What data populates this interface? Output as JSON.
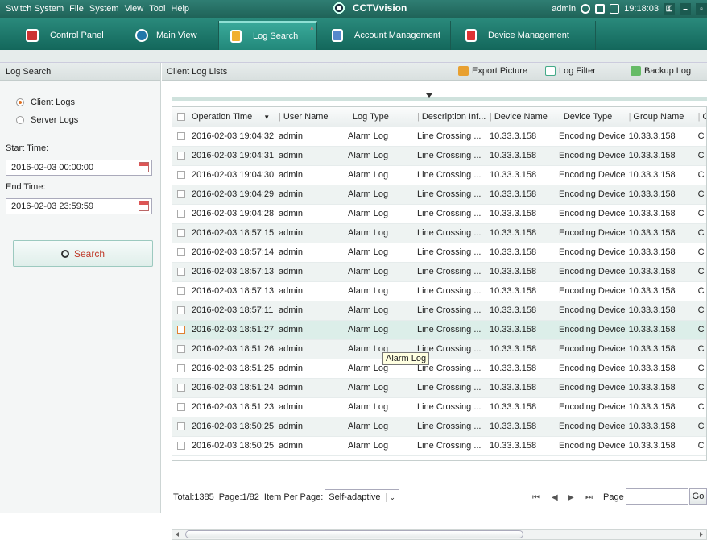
{
  "menu": {
    "items": [
      "Switch System",
      "File",
      "System",
      "View",
      "Tool",
      "Help"
    ]
  },
  "app_title": "CCTVvision",
  "topright": {
    "user": "admin",
    "time": "19:18:03",
    "lock_icon": "lock-icon",
    "minimize": "–",
    "maximize": "▫"
  },
  "tabs": [
    {
      "label": "Control Panel",
      "icon": "home-icon"
    },
    {
      "label": "Main View",
      "icon": "camera-icon"
    },
    {
      "label": "Log Search",
      "icon": "log-icon",
      "close": "×"
    },
    {
      "label": "Account Management",
      "icon": "account-icon"
    },
    {
      "label": "Device Management",
      "icon": "device-icon"
    }
  ],
  "left": {
    "title": "Log Search",
    "radio_client": "Client Logs",
    "radio_server": "Server Logs",
    "start_label": "Start Time:",
    "start_value": "2016-02-03 00:00:00",
    "end_label": "End Time:",
    "end_value": "2016-02-03 23:59:59",
    "search_label": "Search"
  },
  "main": {
    "title": "Client Log Lists",
    "export_label": "Export Picture",
    "filter_label": "Log Filter",
    "backup_label": "Backup Log"
  },
  "table": {
    "headers": [
      "Operation Time",
      "User Name",
      "Log Type",
      "Description Inf...",
      "Device Name",
      "Device Type",
      "Group Name",
      "C"
    ],
    "rows": [
      [
        "2016-02-03 19:04:32",
        "admin",
        "Alarm Log",
        "Line Crossing ...",
        "10.33.3.158",
        "Encoding Device",
        "10.33.3.158",
        "C"
      ],
      [
        "2016-02-03 19:04:31",
        "admin",
        "Alarm Log",
        "Line Crossing ...",
        "10.33.3.158",
        "Encoding Device",
        "10.33.3.158",
        "C"
      ],
      [
        "2016-02-03 19:04:30",
        "admin",
        "Alarm Log",
        "Line Crossing ...",
        "10.33.3.158",
        "Encoding Device",
        "10.33.3.158",
        "C"
      ],
      [
        "2016-02-03 19:04:29",
        "admin",
        "Alarm Log",
        "Line Crossing ...",
        "10.33.3.158",
        "Encoding Device",
        "10.33.3.158",
        "C"
      ],
      [
        "2016-02-03 19:04:28",
        "admin",
        "Alarm Log",
        "Line Crossing ...",
        "10.33.3.158",
        "Encoding Device",
        "10.33.3.158",
        "C"
      ],
      [
        "2016-02-03 18:57:15",
        "admin",
        "Alarm Log",
        "Line Crossing ...",
        "10.33.3.158",
        "Encoding Device",
        "10.33.3.158",
        "C"
      ],
      [
        "2016-02-03 18:57:14",
        "admin",
        "Alarm Log",
        "Line Crossing ...",
        "10.33.3.158",
        "Encoding Device",
        "10.33.3.158",
        "C"
      ],
      [
        "2016-02-03 18:57:13",
        "admin",
        "Alarm Log",
        "Line Crossing ...",
        "10.33.3.158",
        "Encoding Device",
        "10.33.3.158",
        "C"
      ],
      [
        "2016-02-03 18:57:13",
        "admin",
        "Alarm Log",
        "Line Crossing ...",
        "10.33.3.158",
        "Encoding Device",
        "10.33.3.158",
        "C"
      ],
      [
        "2016-02-03 18:57:11",
        "admin",
        "Alarm Log",
        "Line Crossing ...",
        "10.33.3.158",
        "Encoding Device",
        "10.33.3.158",
        "C"
      ],
      [
        "2016-02-03 18:51:27",
        "admin",
        "Alarm Log",
        "Line Crossing ...",
        "10.33.3.158",
        "Encoding Device",
        "10.33.3.158",
        "C"
      ],
      [
        "2016-02-03 18:51:26",
        "admin",
        "Alarm Log",
        "Line Crossing ...",
        "10.33.3.158",
        "Encoding Device",
        "10.33.3.158",
        "C"
      ],
      [
        "2016-02-03 18:51:25",
        "admin",
        "Alarm Log",
        "Line Crossing ...",
        "10.33.3.158",
        "Encoding Device",
        "10.33.3.158",
        "C"
      ],
      [
        "2016-02-03 18:51:24",
        "admin",
        "Alarm Log",
        "Line Crossing ...",
        "10.33.3.158",
        "Encoding Device",
        "10.33.3.158",
        "C"
      ],
      [
        "2016-02-03 18:51:23",
        "admin",
        "Alarm Log",
        "Line Crossing ...",
        "10.33.3.158",
        "Encoding Device",
        "10.33.3.158",
        "C"
      ],
      [
        "2016-02-03 18:50:25",
        "admin",
        "Alarm Log",
        "Line Crossing ...",
        "10.33.3.158",
        "Encoding Device",
        "10.33.3.158",
        "C"
      ],
      [
        "2016-02-03 18:50:25",
        "admin",
        "Alarm Log",
        "Line Crossing ...",
        "10.33.3.158",
        "Encoding Device",
        "10.33.3.158",
        "C"
      ]
    ],
    "selected_row": 10,
    "tooltip": "Alarm Log"
  },
  "footer": {
    "total": "Total:1385",
    "page": "Page:1/82",
    "per_page_label": "Item Per Page:",
    "per_page_value": "Self-adaptive",
    "page_label": "Page",
    "go_label": "Go"
  },
  "colors": {
    "topbar": "#1f6358",
    "accent": "#e07020"
  }
}
